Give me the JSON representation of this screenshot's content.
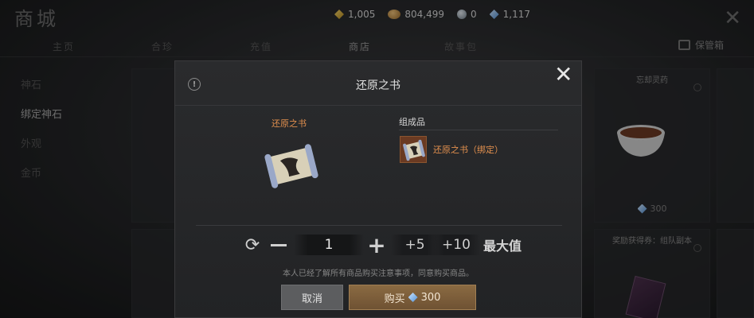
{
  "shop": {
    "title": "商城",
    "currencies": [
      {
        "icon": "gold-ingot-icon",
        "value": "1,005"
      },
      {
        "icon": "copper-coin-icon",
        "value": "804,499"
      },
      {
        "icon": "silver-coin-icon",
        "value": "0"
      },
      {
        "icon": "blue-gem-icon",
        "value": "1,117"
      }
    ],
    "tabs": [
      "主页",
      "合珍",
      "充值",
      "商店",
      "故事包"
    ],
    "active_tab": "商店",
    "vault_label": "保管箱",
    "sidebar": [
      "神石",
      "绑定神石",
      "外观",
      "金币"
    ],
    "active_side": "绑定神石",
    "cards": [
      {
        "title": "忘却灵药",
        "price": "300"
      },
      {
        "title": "奖励获得券：组队副本",
        "price": ""
      }
    ]
  },
  "modal": {
    "title": "还原之书",
    "item_name": "还原之书",
    "components_label": "组成品",
    "component_name": "还原之书（绑定）",
    "quantity": "1",
    "step_small": "+5",
    "step_large": "+10",
    "max_label": "最大值",
    "notice": "本人已经了解所有商品购买注意事项，同意购买商品。",
    "cancel_label": "取消",
    "buy_label": "购买",
    "buy_price": "300"
  },
  "colors": {
    "item_name": "#e3904e",
    "buy_button": "#7d5e3b"
  }
}
